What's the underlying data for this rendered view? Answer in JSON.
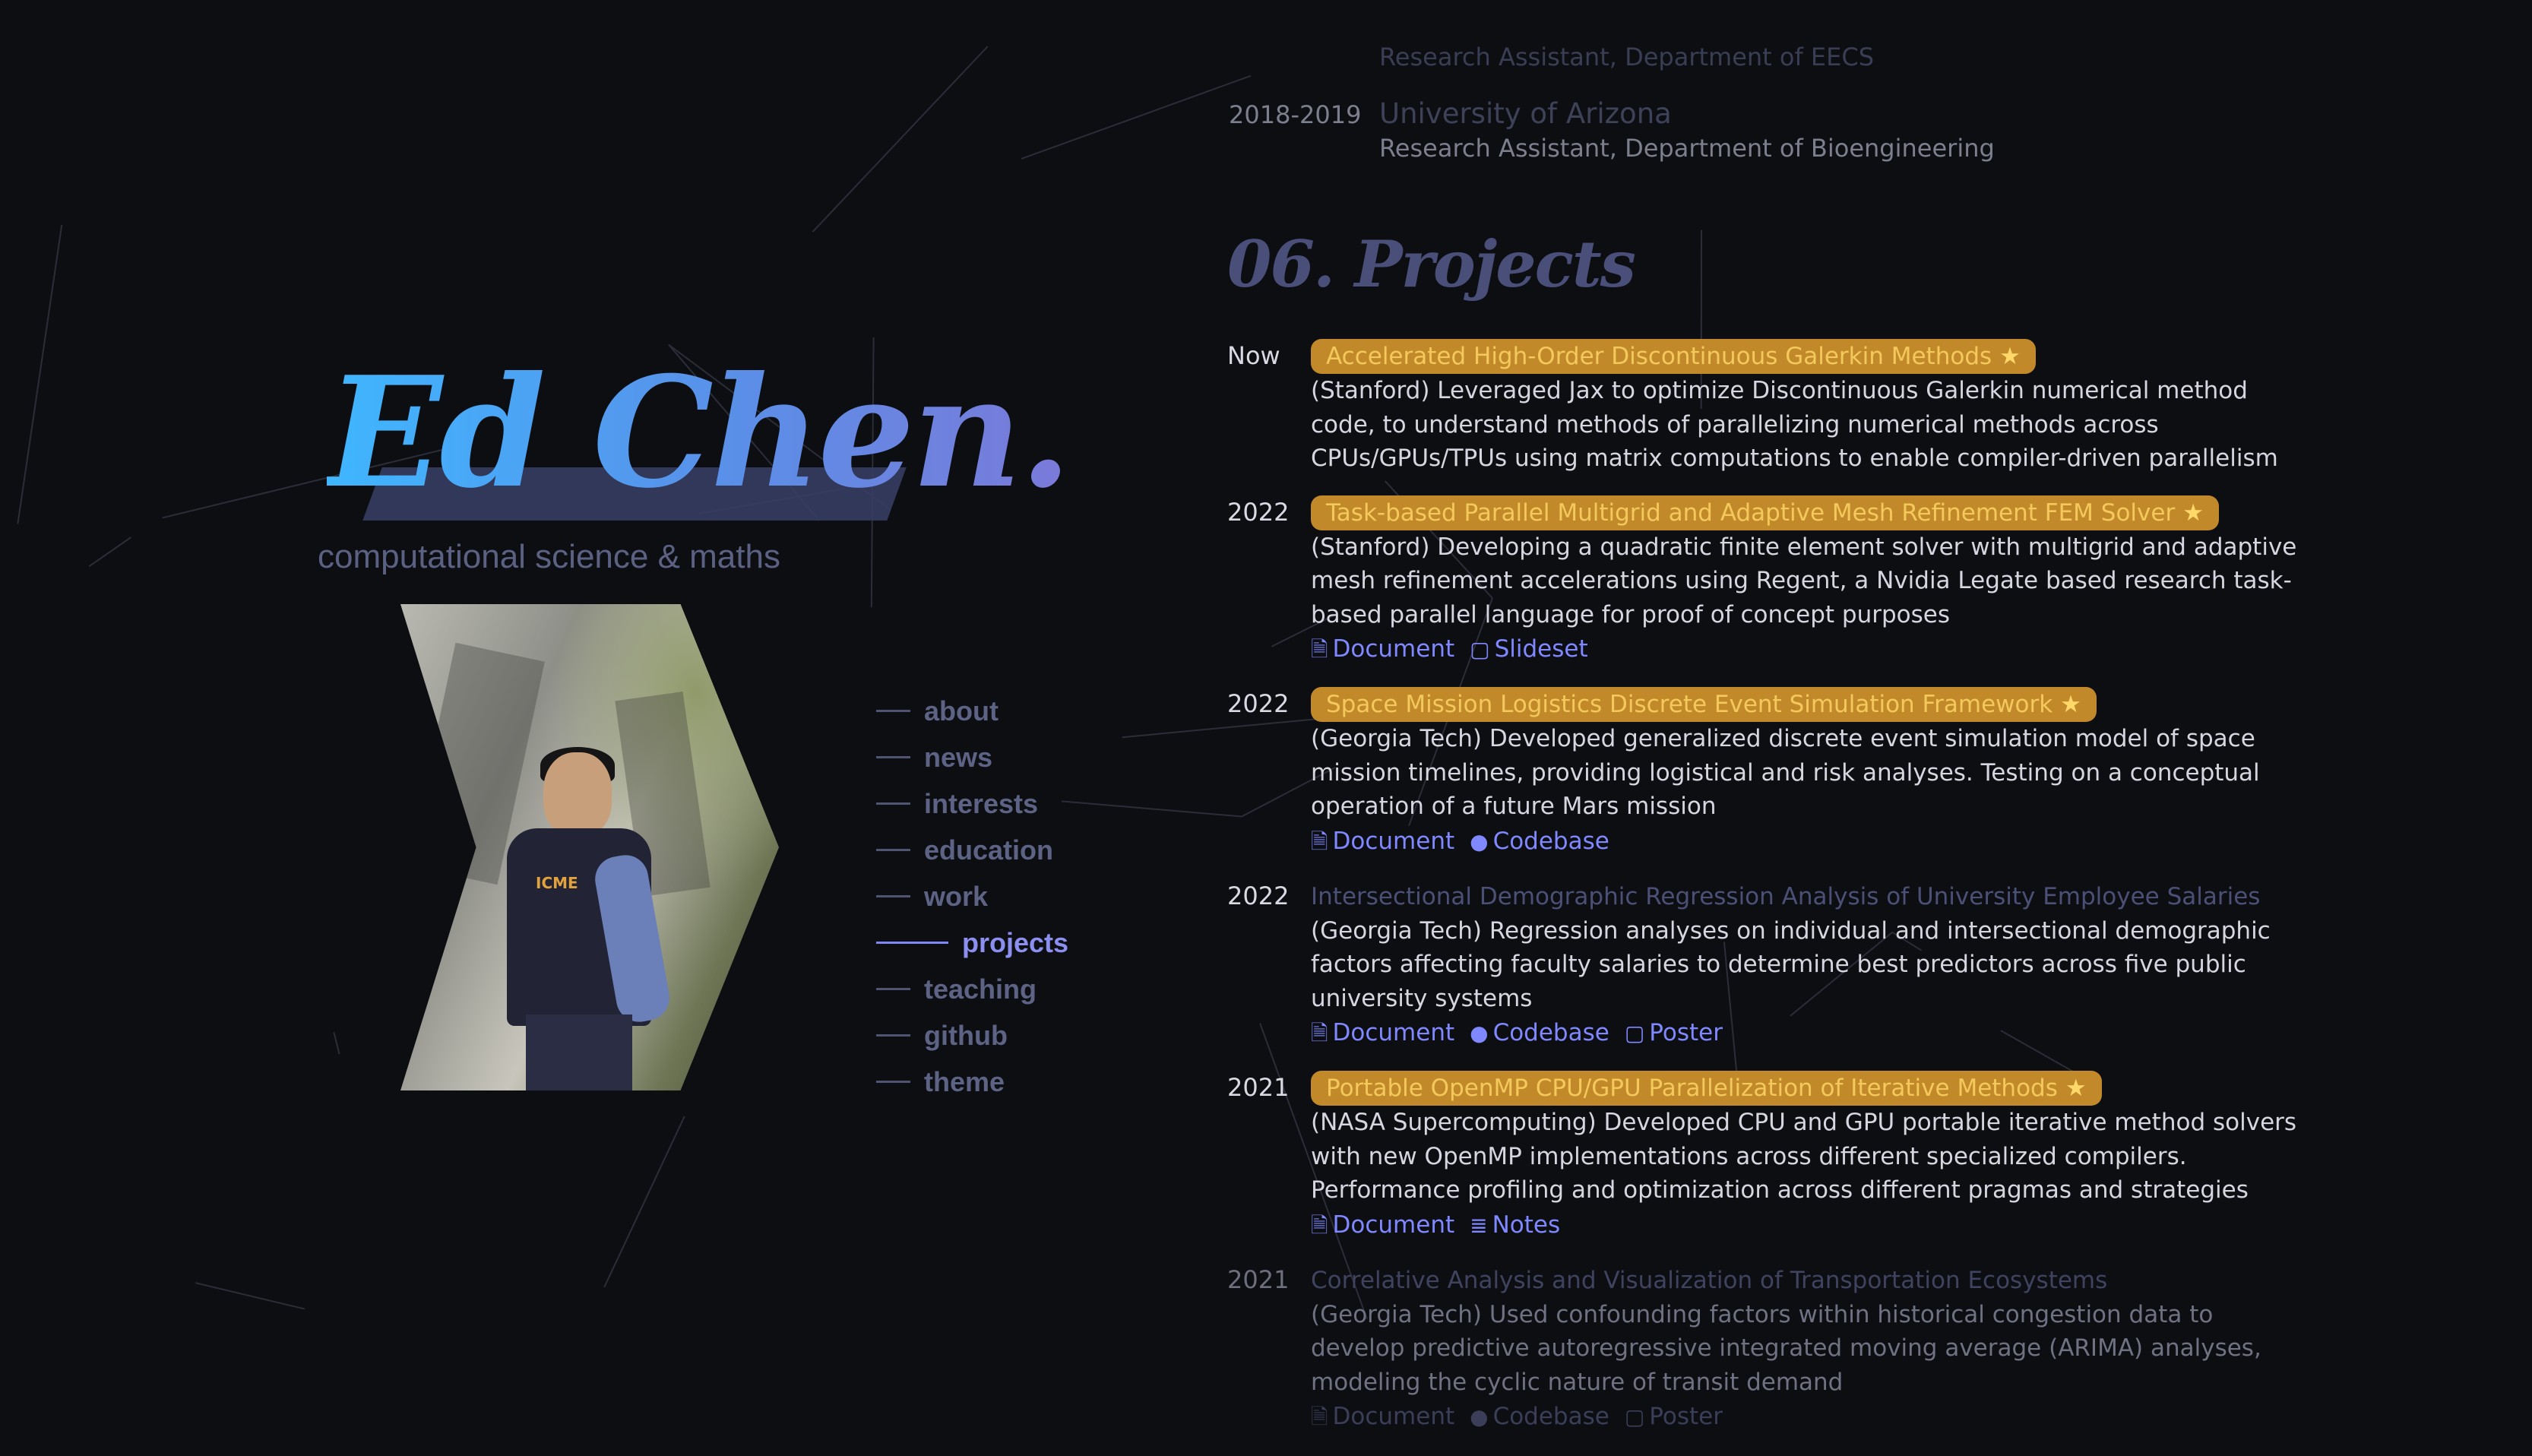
{
  "hero": {
    "name": "Ed Chen.",
    "subtitle": "computational science & maths"
  },
  "nav": [
    {
      "label": "about",
      "active": false
    },
    {
      "label": "news",
      "active": false
    },
    {
      "label": "interests",
      "active": false
    },
    {
      "label": "education",
      "active": false
    },
    {
      "label": "work",
      "active": false
    },
    {
      "label": "projects",
      "active": true
    },
    {
      "label": "teaching",
      "active": false
    },
    {
      "label": "github",
      "active": false
    },
    {
      "label": "theme",
      "active": false
    }
  ],
  "work_tail": {
    "prev_role": "Research Assistant, Department of EECS",
    "year": "2018-2019",
    "school": "University of Arizona",
    "role": "Research Assistant, Department of Bioengineering"
  },
  "projects_section": {
    "title": "06. Projects",
    "items": [
      {
        "year": "Now",
        "title": "Accelerated High-Order Discontinuous Galerkin Methods",
        "starred": true,
        "desc": "(Stanford) Leveraged Jax to optimize Discontinuous Galerkin numerical method code, to understand methods of parallelizing numerical methods across CPUs/GPUs/TPUs using matrix computations to enable compiler-driven parallelism",
        "links": []
      },
      {
        "year": "2022",
        "title": "Task-based Parallel Multigrid and Adaptive Mesh Refinement FEM Solver",
        "starred": true,
        "desc": "(Stanford) Developing a quadratic finite element solver with multigrid and adaptive mesh refinement accelerations using Regent, a Nvidia Legate based research task-based parallel language for proof of concept purposes",
        "links": [
          {
            "label": "Document",
            "icon": "document-icon"
          },
          {
            "label": "Slideset",
            "icon": "slides-icon"
          }
        ]
      },
      {
        "year": "2022",
        "title": "Space Mission Logistics Discrete Event Simulation Framework",
        "starred": true,
        "desc": "(Georgia Tech) Developed generalized discrete event simulation model of space mission timelines, providing logistical and risk analyses. Testing on a conceptual operation of a future Mars mission",
        "links": [
          {
            "label": "Document",
            "icon": "document-icon"
          },
          {
            "label": "Codebase",
            "icon": "github-icon"
          }
        ]
      },
      {
        "year": "2022",
        "title": "Intersectional Demographic Regression Analysis of University Employee Salaries",
        "starred": false,
        "desc": "(Georgia Tech) Regression analyses on individual and intersectional demographic factors affecting faculty salaries to determine best predictors across five public university systems",
        "links": [
          {
            "label": "Document",
            "icon": "document-icon"
          },
          {
            "label": "Codebase",
            "icon": "github-icon"
          },
          {
            "label": "Poster",
            "icon": "poster-icon"
          }
        ]
      },
      {
        "year": "2021",
        "title": "Portable OpenMP CPU/GPU Parallelization of Iterative Methods",
        "starred": true,
        "desc": "(NASA Supercomputing) Developed CPU and GPU portable iterative method solvers with new OpenMP implementations across different specialized compilers. Performance profiling and optimization across different pragmas and strategies",
        "links": [
          {
            "label": "Document",
            "icon": "document-icon"
          },
          {
            "label": "Notes",
            "icon": "notes-icon"
          }
        ]
      },
      {
        "year": "2021",
        "title": "Correlative Analysis and Visualization of Transportation Ecosystems",
        "starred": false,
        "faded": true,
        "desc": "(Georgia Tech) Used confounding factors within historical congestion data to develop predictive autoregressive integrated moving average (ARIMA) analyses, modeling the cyclic nature of transit demand",
        "links": [
          {
            "label": "Document",
            "icon": "document-icon"
          },
          {
            "label": "Codebase",
            "icon": "github-icon"
          },
          {
            "label": "Poster",
            "icon": "poster-icon"
          }
        ]
      }
    ]
  }
}
